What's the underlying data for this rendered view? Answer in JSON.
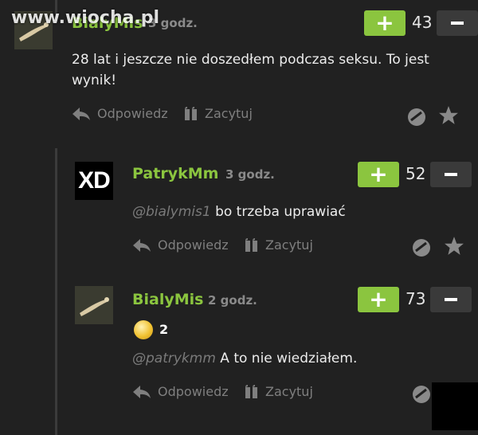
{
  "watermark": "www.wiocha.pl",
  "comments": [
    {
      "username": "BialyMis",
      "time": "3 godz.",
      "score": "43",
      "text": "28 lat i jeszcze nie doszedłem podczas seksu. To jest wynik!",
      "reply_label": "Odpowiedz",
      "quote_label": "Zacytuj"
    },
    {
      "avatar_text": "XD",
      "username": "PatrykMm",
      "time": "3 godz.",
      "score": "52",
      "mention": "@bialymis1",
      "text": " bo trzeba uprawiać",
      "reply_label": "Odpowiedz",
      "quote_label": "Zacytuj"
    },
    {
      "username": "BialyMis",
      "time": "2 godz.",
      "score": "73",
      "badge_count": "2",
      "mention": "@patrykmm",
      "text": " A to nie wiedziałem.",
      "reply_label": "Odpowiedz",
      "quote_label": "Zacytuj"
    }
  ],
  "vote": {
    "plus": "+"
  },
  "colors": {
    "accent": "#8bc53f",
    "background": "#212121"
  }
}
